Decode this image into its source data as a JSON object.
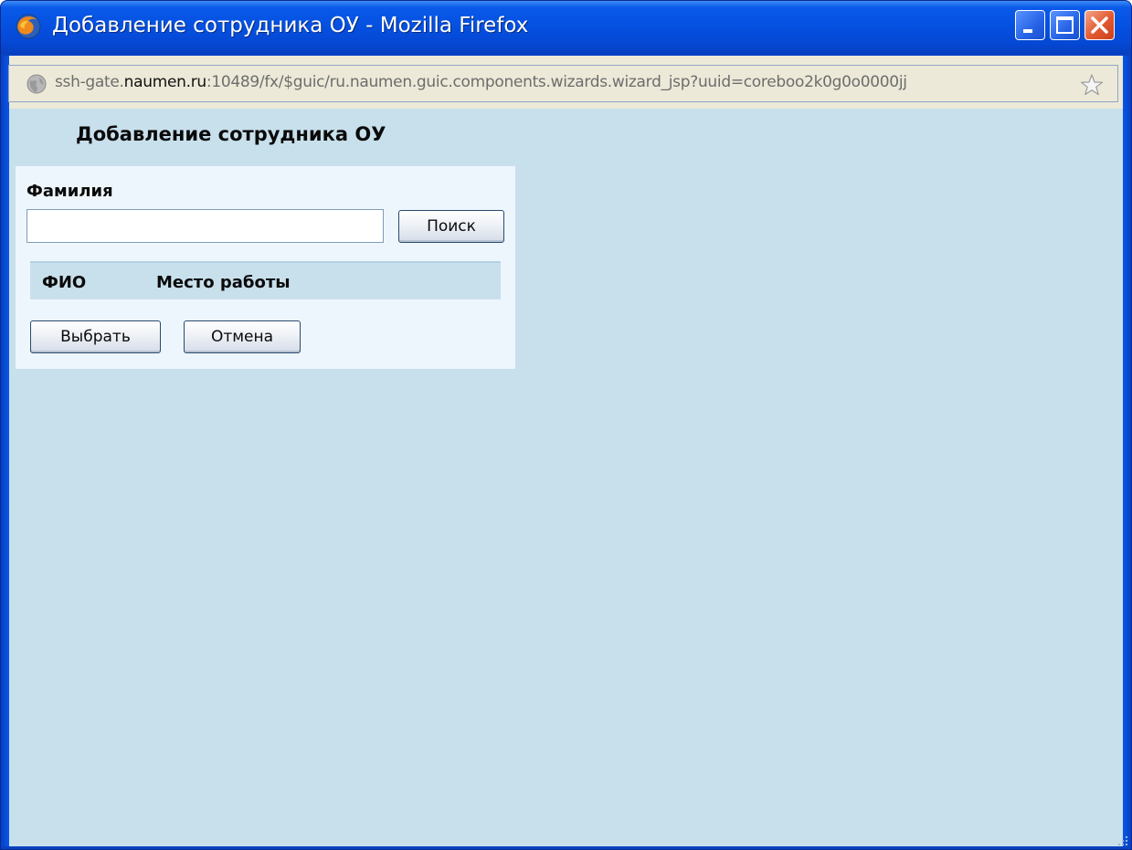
{
  "window": {
    "title": "Добавление сотрудника ОУ - Mozilla Firefox",
    "icon": "firefox-icon",
    "controls": [
      "minimize-icon",
      "maximize-icon",
      "close-icon"
    ]
  },
  "address_bar": {
    "url_prefix": "ssh-gate.",
    "url_host": "naumen.ru",
    "url_rest": ":10489/fx/$guic/ru.naumen.guic.components.wizards.wizard_jsp?uuid=coreboo2k0g0o0000jj",
    "left_icon": "globe-icon",
    "right_icon": "star-icon"
  },
  "page": {
    "heading": "Добавление сотрудника ОУ",
    "surname_label": "Фамилия",
    "surname_value": "",
    "search_button": "Поиск",
    "table": {
      "columns": [
        "ФИО",
        "Место работы"
      ],
      "rows": []
    },
    "select_button": "Выбрать",
    "cancel_button": "Отмена"
  },
  "colors": {
    "titlebar": "#0551e1",
    "content_bg": "#c8e0ec",
    "panel_bg": "#eef6fd"
  }
}
